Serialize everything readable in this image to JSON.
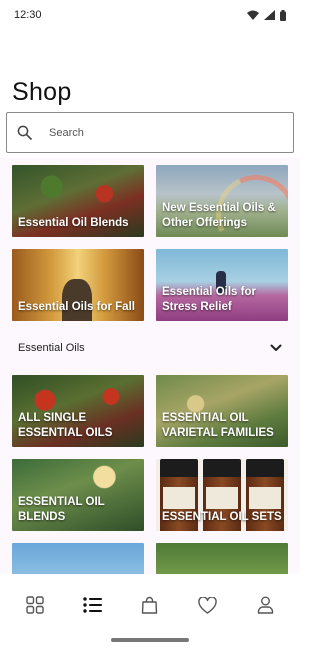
{
  "status_bar": {
    "time": "12:30"
  },
  "page": {
    "title": "Shop"
  },
  "search": {
    "placeholder": "Search"
  },
  "top_tiles": [
    {
      "label": "Essential Oil Blends"
    },
    {
      "label": "New Essential Oils & Other Offerings"
    },
    {
      "label": "Essential Oils for Fall"
    },
    {
      "label": "Essential Oils for Stress Relief"
    }
  ],
  "section": {
    "label": "Essential Oils"
  },
  "category_tiles": [
    {
      "label": "ALL SINGLE ESSENTIAL OILS"
    },
    {
      "label": "ESSENTIAL OIL VARIETAL FAMILIES"
    },
    {
      "label": "ESSENTIAL OIL BLENDS"
    },
    {
      "label": "ESSENTIAL OIL SETS"
    }
  ],
  "bottom_nav": [
    {
      "icon": "grid-icon"
    },
    {
      "icon": "list-icon",
      "active": true
    },
    {
      "icon": "shopping-bag-icon"
    },
    {
      "icon": "heart-icon"
    },
    {
      "icon": "profile-icon"
    }
  ],
  "colors": {
    "content_background": "#fdf8fd",
    "text": "#1b1b1b",
    "icon": "#555555"
  }
}
